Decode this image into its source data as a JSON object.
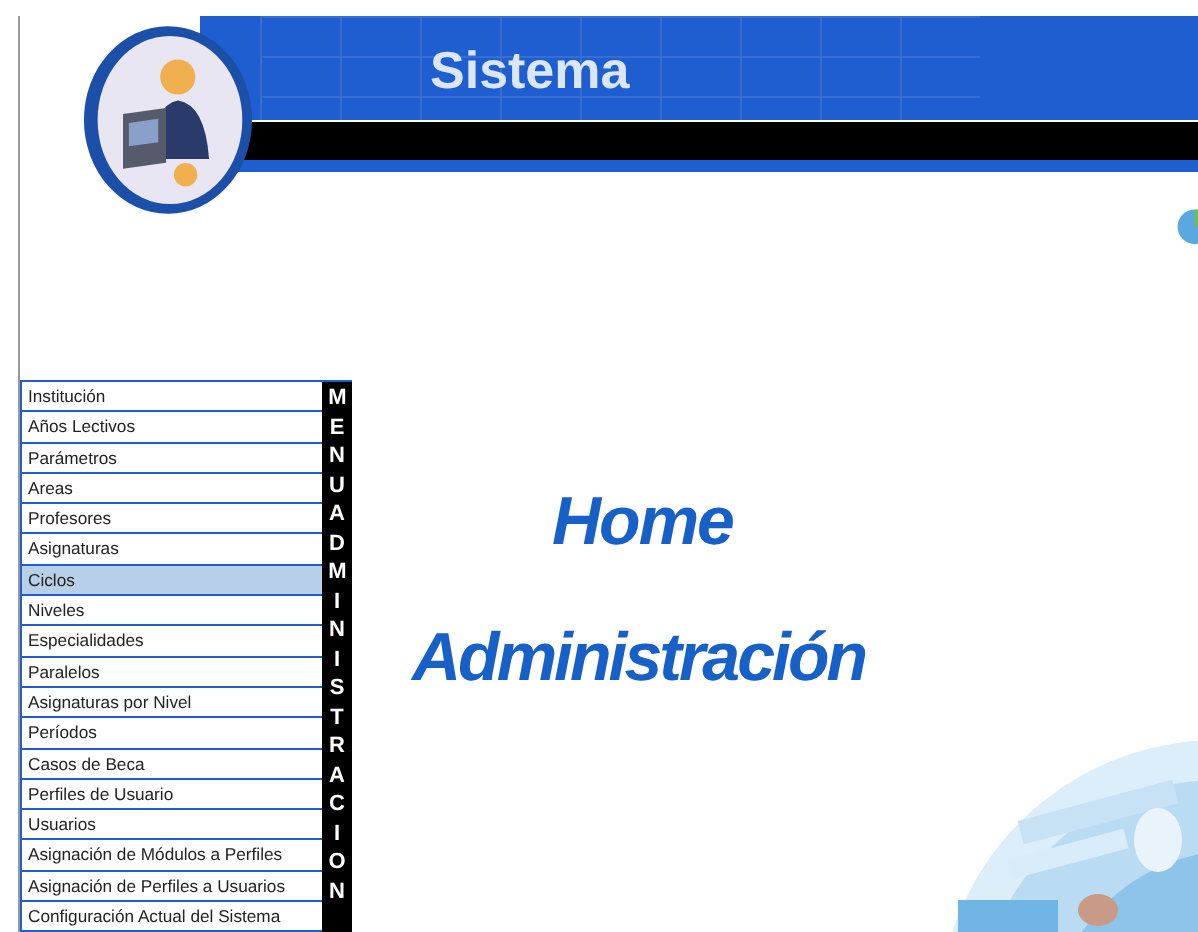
{
  "header": {
    "title": "Sistema"
  },
  "menu": {
    "caption": "MENU ADMINISTRACION",
    "items": [
      {
        "label": "Institución",
        "selected": false
      },
      {
        "label": "Años Lectivos",
        "selected": false
      },
      {
        "label": "Parámetros",
        "selected": false
      },
      {
        "label": "Areas",
        "selected": false
      },
      {
        "label": "Profesores",
        "selected": false
      },
      {
        "label": "Asignaturas",
        "selected": false
      },
      {
        "label": "Ciclos",
        "selected": true
      },
      {
        "label": "Niveles",
        "selected": false
      },
      {
        "label": "Especialidades",
        "selected": false
      },
      {
        "label": "Paralelos",
        "selected": false
      },
      {
        "label": "Asignaturas por Nivel",
        "selected": false
      },
      {
        "label": "Períodos",
        "selected": false
      },
      {
        "label": "Casos de Beca",
        "selected": false
      },
      {
        "label": "Perfiles de Usuario",
        "selected": false
      },
      {
        "label": "Usuarios",
        "selected": false
      },
      {
        "label": "Asignación de Módulos a Perfiles",
        "selected": false
      },
      {
        "label": "Asignación de Perfiles a Usuarios",
        "selected": false
      },
      {
        "label": "Configuración Actual del Sistema",
        "selected": false
      }
    ]
  },
  "main": {
    "heading": "Home",
    "subheading": "Administración"
  }
}
